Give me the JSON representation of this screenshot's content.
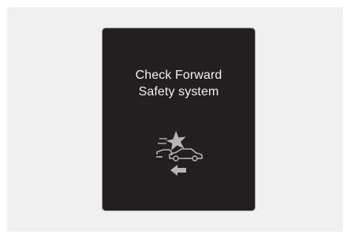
{
  "display": {
    "message_line_1": "Check Forward",
    "message_line_2": "Safety system",
    "icon": "forward-collision-warning-icon",
    "colors": {
      "background": "#231f20",
      "text": "#f2f2f2",
      "icon": "#b5b5b5",
      "frame": "#9a9a9a"
    }
  }
}
